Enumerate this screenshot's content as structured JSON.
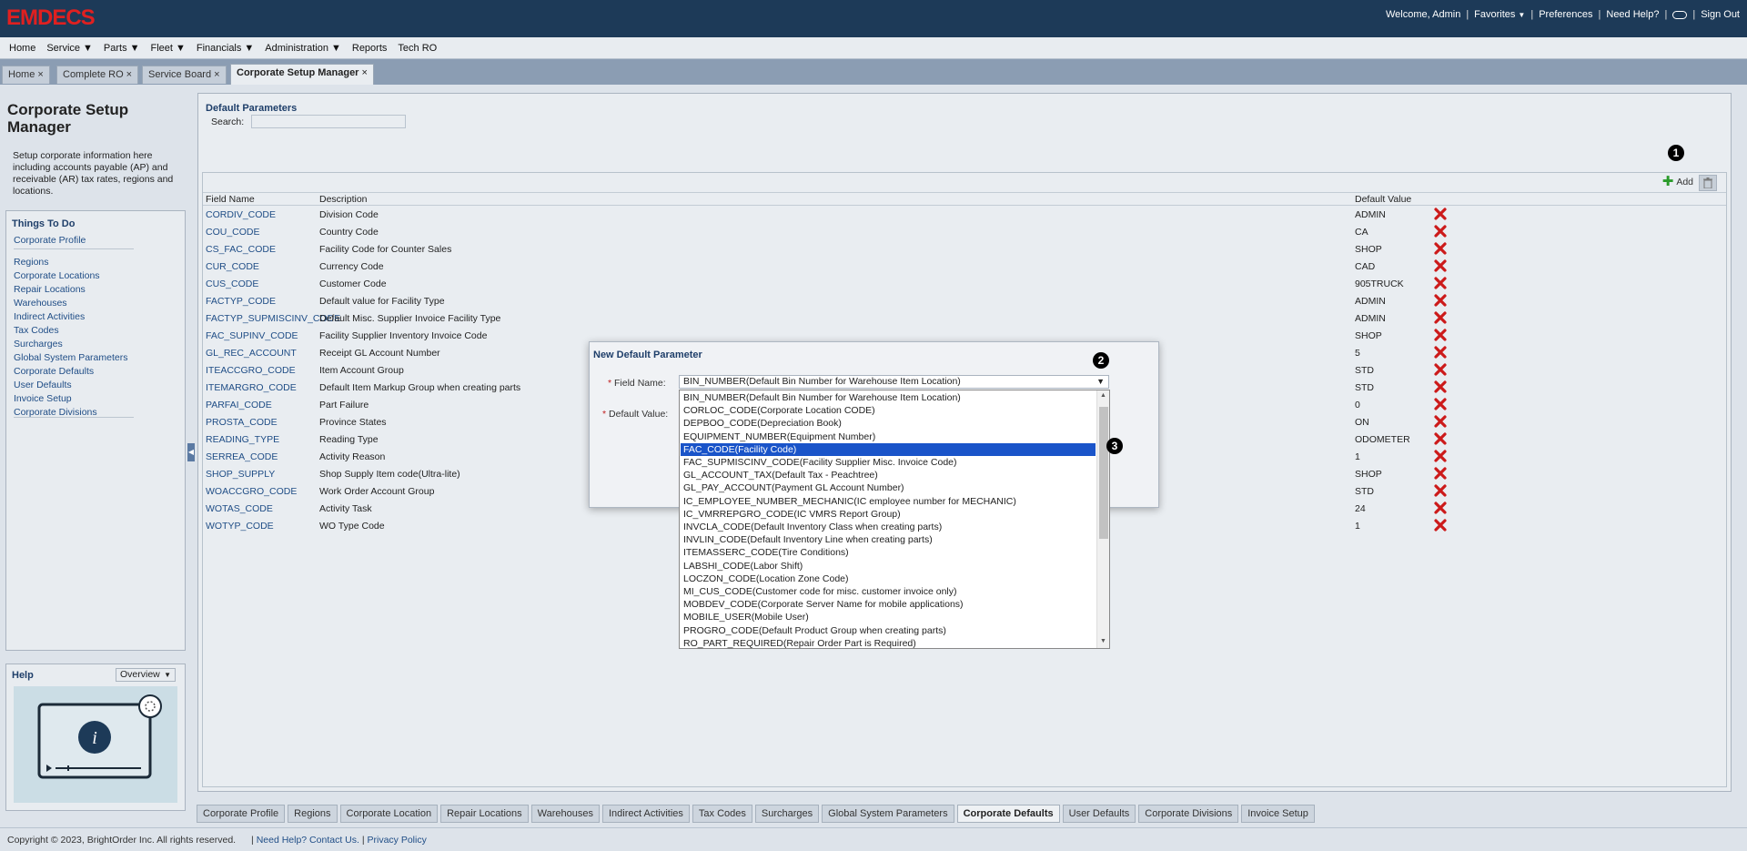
{
  "app": {
    "logo": "EMDECS"
  },
  "user_links": {
    "welcome": "Welcome, Admin",
    "favorites": "Favorites",
    "preferences": "Preferences",
    "help": "Need Help?",
    "signout": "Sign Out"
  },
  "menu": [
    "Home",
    "Service",
    "Parts",
    "Fleet",
    "Financials",
    "Administration",
    "Reports",
    "Tech RO"
  ],
  "tabs": [
    "Home",
    "Complete RO",
    "Service Board",
    "Corporate Setup Manager"
  ],
  "left": {
    "title": "Corporate Setup Manager",
    "description": "Setup corporate information here including accounts payable (AP) and receivable (AR) tax rates, regions and locations.",
    "things_title": "Things To Do",
    "todo_first": "Corporate Profile",
    "todo": [
      "Regions",
      "Corporate Locations",
      "Repair Locations",
      "Warehouses",
      "Indirect Activities",
      "Tax Codes",
      "Surcharges",
      "Global System Parameters",
      "Corporate Defaults",
      "User Defaults",
      "Invoice Setup",
      "Corporate Divisions"
    ],
    "help_title": "Help",
    "help_select": "Overview"
  },
  "content": {
    "section_title": "Default Parameters",
    "search_label": "Search:",
    "add_label": "Add",
    "columns": [
      "Field Name",
      "Description",
      "Default Value"
    ],
    "rows": [
      [
        "CORDIV_CODE",
        "Division Code",
        "ADMIN"
      ],
      [
        "COU_CODE",
        "Country Code",
        "CA"
      ],
      [
        "CS_FAC_CODE",
        "Facility Code for Counter Sales",
        "SHOP"
      ],
      [
        "CUR_CODE",
        "Currency Code",
        "CAD"
      ],
      [
        "CUS_CODE",
        "Customer Code",
        "905TRUCK"
      ],
      [
        "FACTYP_CODE",
        "Default value for Facility Type",
        "ADMIN"
      ],
      [
        "FACTYP_SUPMISCINV_CODE",
        "Default Misc. Supplier Invoice Facility Type",
        "ADMIN"
      ],
      [
        "FAC_SUPINV_CODE",
        "Facility Supplier Inventory Invoice Code",
        "SHOP"
      ],
      [
        "GL_REC_ACCOUNT",
        "Receipt GL Account Number",
        "5"
      ],
      [
        "ITEACCGRO_CODE",
        "Item Account Group",
        "STD"
      ],
      [
        "ITEMARGRO_CODE",
        "Default Item Markup Group when creating parts",
        "STD"
      ],
      [
        "PARFAI_CODE",
        "Part Failure",
        "0"
      ],
      [
        "PROSTA_CODE",
        "Province States",
        "ON"
      ],
      [
        "READING_TYPE",
        "Reading Type",
        "ODOMETER"
      ],
      [
        "SERREA_CODE",
        "Activity Reason",
        "1"
      ],
      [
        "SHOP_SUPPLY",
        "Shop Supply Item code(Ultra-lite)",
        "SHOP"
      ],
      [
        "WOACCGRO_CODE",
        "Work Order Account Group",
        "STD"
      ],
      [
        "WOTAS_CODE",
        "Activity Task",
        "24"
      ],
      [
        "WOTYP_CODE",
        "WO Type Code",
        "1"
      ]
    ]
  },
  "bottom_tabs": [
    "Corporate Profile",
    "Regions",
    "Corporate Location",
    "Repair Locations",
    "Warehouses",
    "Indirect Activities",
    "Tax Codes",
    "Surcharges",
    "Global System Parameters",
    "Corporate Defaults",
    "User Defaults",
    "Corporate Divisions",
    "Invoice Setup"
  ],
  "bottom_active": "Corporate Defaults",
  "footer": {
    "copyright": "Copyright © 2023, BrightOrder Inc. All rights reserved.",
    "help": "Need Help? Contact Us.",
    "privacy": "Privacy Policy"
  },
  "modal": {
    "title": "New Default Parameter",
    "field_name_label": "Field Name:",
    "default_value_label": "Default Value:",
    "selected_value": "BIN_NUMBER(Default Bin Number for Warehouse Item Location)",
    "options": [
      "BIN_NUMBER(Default Bin Number for Warehouse Item Location)",
      "CORLOC_CODE(Corporate Location CODE)",
      "DEPBOO_CODE(Depreciation Book)",
      "EQUIPMENT_NUMBER(Equipment Number)",
      "FAC_CODE(Facility Code)",
      "FAC_SUPMISCINV_CODE(Facility Supplier Misc. Invoice Code)",
      "GL_ACCOUNT_TAX(Default Tax - Peachtree)",
      "GL_PAY_ACCOUNT(Payment GL Account Number)",
      "IC_EMPLOYEE_NUMBER_MECHANIC(IC employee number for MECHANIC)",
      "IC_VMRREPGRO_CODE(IC VMRS Report Group)",
      "INVCLA_CODE(Default Inventory Class when creating parts)",
      "INVLIN_CODE(Default Inventory Line when creating parts)",
      "ITEMASSERC_CODE(Tire Conditions)",
      "LABSHI_CODE(Labor Shift)",
      "LOCZON_CODE(Location Zone Code)",
      "MI_CUS_CODE(Customer code for misc. customer invoice only)",
      "MOBDEV_CODE(Corporate Server Name for mobile applications)",
      "MOBILE_USER(Mobile User)",
      "PROGRO_CODE(Default Product Group when creating parts)",
      "RO_PART_REQUIRED(Repair Order Part is Required)"
    ],
    "highlighted_index": 4
  },
  "callouts": [
    "1",
    "2",
    "3"
  ],
  "colors": {
    "header": "#1d3a58",
    "logo": "#e02020",
    "link": "#1f4d86",
    "selection": "#1a54c9",
    "delete": "#cc1a1a"
  }
}
